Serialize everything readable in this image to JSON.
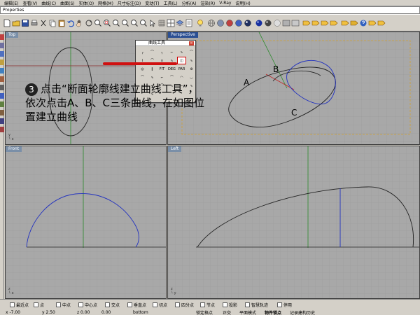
{
  "menubar": {
    "items": [
      "编辑(E)",
      "查看(V)",
      "曲线(C)",
      "曲面(S)",
      "实体(O)",
      "网格(M)",
      "尺寸标注(D)",
      "变动(T)",
      "工具(L)",
      "分析(A)",
      "渲染(R)",
      "V-Ray",
      "说明(H)"
    ]
  },
  "command": {
    "text": "Properties"
  },
  "viewports": {
    "top": {
      "title": "Top"
    },
    "perspective": {
      "title": "Perspective"
    },
    "front": {
      "title": "Front"
    },
    "left": {
      "title": "Left"
    }
  },
  "labels": {
    "a": "A",
    "b": "B",
    "c": "C"
  },
  "palette": {
    "title": "曲线工具",
    "close": "×",
    "cells": [
      "╭",
      "⌒",
      "╮",
      "⌐",
      "∿",
      "⌒",
      "⌇",
      "⌒",
      "∩",
      "∿",
      "◫",
      "∿",
      "◎",
      "∥",
      "FIT",
      "DEG",
      "PAR",
      "⊛",
      "⌒",
      "∿",
      "⌐",
      "⌒",
      "◠",
      "◡",
      "∿",
      "⌐",
      "⌒",
      "∿",
      "⌐",
      "∿",
      "⌒",
      "∿"
    ]
  },
  "annotation": {
    "step": "3",
    "text": "点击“断面轮廓线建立曲线工具”，依次点击A、B、C三条曲线，在如图位置建立曲线"
  },
  "osnap": {
    "items": [
      "最近点",
      "点",
      "中点",
      "中心点",
      "交点",
      "垂直点",
      "切点",
      "四分点",
      "节点",
      "投影",
      "智慧轨迹",
      "停用"
    ]
  },
  "status": {
    "x": "x -7.00",
    "y": "y 2.50",
    "z": "z 0.00",
    "layer": "0.00",
    "obj": "bottom",
    "grid": "锁定格点",
    "ortho": "正交",
    "planar": "平面模式",
    "osnap": "物件锁点",
    "history": "记录建构历史"
  }
}
